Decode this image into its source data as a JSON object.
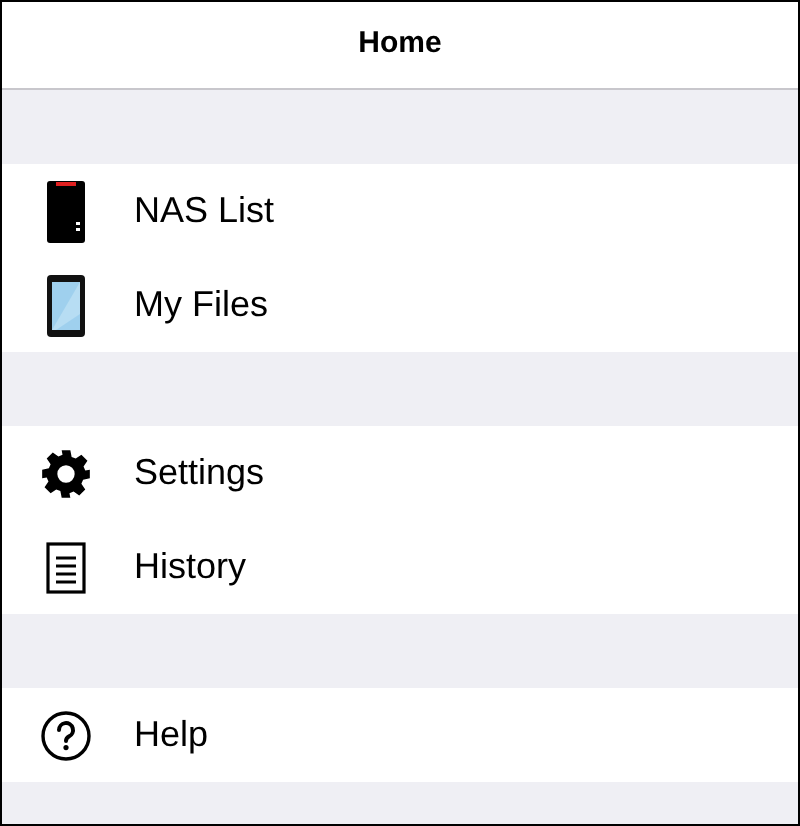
{
  "header": {
    "title": "Home"
  },
  "groups": [
    {
      "items": [
        {
          "kind": "nas",
          "label": "NAS List"
        },
        {
          "kind": "phone",
          "label": "My Files"
        }
      ]
    },
    {
      "items": [
        {
          "kind": "settings",
          "label": "Settings"
        },
        {
          "kind": "history",
          "label": "History"
        }
      ]
    },
    {
      "items": [
        {
          "kind": "help",
          "label": "Help"
        }
      ]
    }
  ]
}
